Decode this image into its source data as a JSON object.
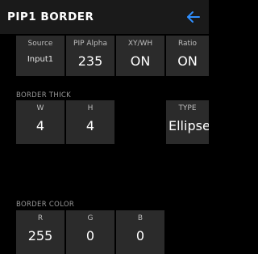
{
  "header": {
    "title": "PIP1 BORDER",
    "back_icon": "back-arrow-icon",
    "accent_color": "#2f8fff"
  },
  "top_row": {
    "source": {
      "label": "Source",
      "value": "Input1"
    },
    "pip_alpha": {
      "label": "PIP Alpha",
      "value": "235"
    },
    "xywh": {
      "label": "XY/WH",
      "value": "ON"
    },
    "ratio": {
      "label": "Ratio",
      "value": "ON"
    }
  },
  "border_thick": {
    "section_label": "BORDER THICK",
    "w": {
      "label": "W",
      "value": "4"
    },
    "h": {
      "label": "H",
      "value": "4"
    },
    "type": {
      "label": "TYPE",
      "value": "Ellipse"
    }
  },
  "border_color": {
    "section_label": "BORDER COLOR",
    "r": {
      "label": "R",
      "value": "255"
    },
    "g": {
      "label": "G",
      "value": "0"
    },
    "b": {
      "label": "B",
      "value": "0"
    }
  }
}
